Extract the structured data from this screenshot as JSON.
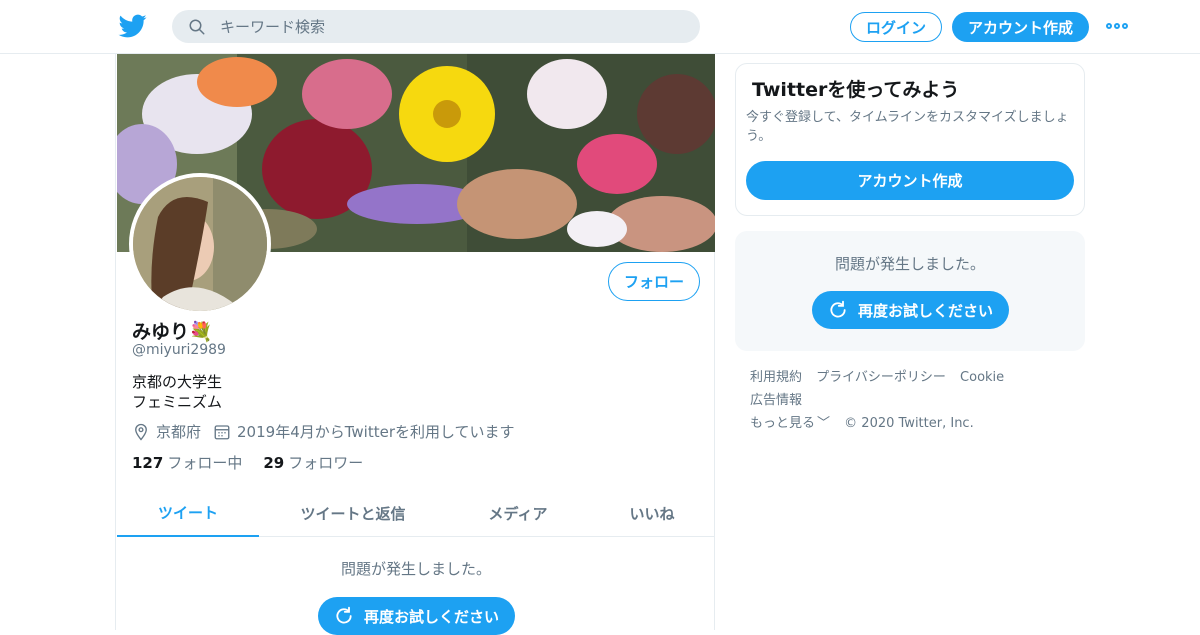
{
  "header": {
    "search_placeholder": "キーワード検索",
    "login_label": "ログイン",
    "signup_label": "アカウント作成",
    "logo_icon": "twitter-bird-icon",
    "accent_color": "#1da1f2"
  },
  "profile": {
    "display_name": "みゆり💐",
    "handle": "@miyuri2989",
    "bio_line1": "京都の大学生",
    "bio_line2": "フェミニズム",
    "location": "京都府",
    "joined": "2019年4月からTwitterを利用しています",
    "following_count": "127",
    "following_label": "フォロー中",
    "followers_count": "29",
    "followers_label": "フォロワー",
    "follow_button": "フォロー"
  },
  "tabs": [
    {
      "label": "ツイート",
      "active": true
    },
    {
      "label": "ツイートと返信",
      "active": false
    },
    {
      "label": "メディア",
      "active": false
    },
    {
      "label": "いいね",
      "active": false
    }
  ],
  "timeline": {
    "error_message": "問題が発生しました。",
    "retry_label": "再度お試しください"
  },
  "sidebar": {
    "signup_card": {
      "title": "Twitterを使ってみよう",
      "subtitle": "今すぐ登録して、タイムラインをカスタマイズしましょう。",
      "button": "アカウント作成"
    },
    "error_panel": {
      "message": "問題が発生しました。",
      "retry_label": "再度お試しください"
    },
    "footer": {
      "links": [
        "利用規約",
        "プライバシーポリシー",
        "Cookie",
        "広告情報"
      ],
      "more": "もっと見る",
      "copyright": "© 2020 Twitter, Inc."
    }
  }
}
